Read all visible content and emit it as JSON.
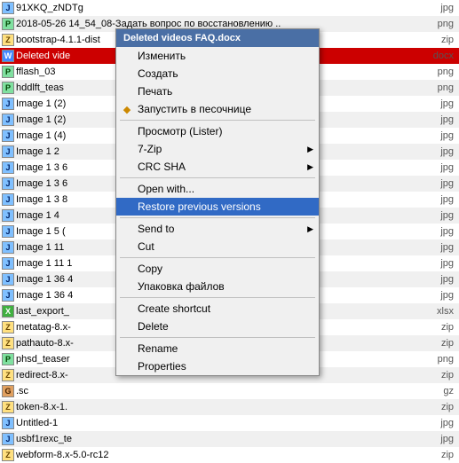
{
  "fileList": {
    "rows": [
      {
        "icon": "jpg",
        "name": "91XKQ_zNDTg",
        "ext": "jpg"
      },
      {
        "icon": "png",
        "name": "2018-05-26 14_54_08-Задать вопрос по восстановлению ..",
        "ext": "png"
      },
      {
        "icon": "zip",
        "name": "bootstrap-4.1.1-dist",
        "ext": "zip"
      },
      {
        "icon": "docx",
        "name": "Deleted vide",
        "ext": "docx",
        "highlighted": true
      },
      {
        "icon": "png",
        "name": "fflash_03",
        "ext": "png"
      },
      {
        "icon": "png",
        "name": "hddlft_teas",
        "ext": "png"
      },
      {
        "icon": "jpg",
        "name": "Image 1 (2)",
        "ext": "jpg"
      },
      {
        "icon": "jpg",
        "name": "Image 1 (2)",
        "ext": "jpg"
      },
      {
        "icon": "jpg",
        "name": "Image 1 (4)",
        "ext": "jpg"
      },
      {
        "icon": "jpg",
        "name": "Image 1 2",
        "ext": "jpg"
      },
      {
        "icon": "jpg",
        "name": "Image 1  3 6",
        "ext": "jpg"
      },
      {
        "icon": "jpg",
        "name": "Image 1  3 6",
        "ext": "jpg"
      },
      {
        "icon": "jpg",
        "name": "Image 1  3 8",
        "ext": "jpg"
      },
      {
        "icon": "jpg",
        "name": "Image 1  4",
        "ext": "jpg"
      },
      {
        "icon": "jpg",
        "name": "Image 1  5 (",
        "ext": "jpg"
      },
      {
        "icon": "jpg",
        "name": "Image 1  11",
        "ext": "jpg"
      },
      {
        "icon": "jpg",
        "name": "Image 1  11 1",
        "ext": "jpg"
      },
      {
        "icon": "jpg",
        "name": "Image 1  36 4",
        "ext": "jpg"
      },
      {
        "icon": "jpg",
        "name": "Image 1  36 4",
        "ext": "jpg"
      },
      {
        "icon": "xlsx",
        "name": "last_export_",
        "ext": "xlsx"
      },
      {
        "icon": "zip",
        "name": "metatag-8.x-",
        "ext": "zip"
      },
      {
        "icon": "zip",
        "name": "pathauto-8.x-",
        "ext": "zip"
      },
      {
        "icon": "png",
        "name": "phsd_teaser",
        "ext": "png"
      },
      {
        "icon": "zip",
        "name": "redirect-8.x-",
        "ext": "zip"
      },
      {
        "icon": "gz",
        "name": ".sc",
        "ext": "gz"
      },
      {
        "icon": "zip",
        "name": "token-8.x-1.",
        "ext": "zip"
      },
      {
        "icon": "jpg",
        "name": "Untitled-1",
        "ext": "jpg"
      },
      {
        "icon": "jpg",
        "name": "usbf1rexc_te",
        "ext": "jpg"
      },
      {
        "icon": "zip",
        "name": "webform-8.x-5.0-rc12",
        "ext": "zip"
      }
    ]
  },
  "contextMenu": {
    "header": "Deleted videos FAQ.docx",
    "items": [
      {
        "label": "Изменить",
        "type": "item"
      },
      {
        "label": "Создать",
        "type": "item"
      },
      {
        "label": "Печать",
        "type": "item"
      },
      {
        "label": "Запустить в песочнице",
        "type": "item",
        "icon": "gem"
      },
      {
        "label": "Просмотр (Lister)",
        "type": "item"
      },
      {
        "label": "7-Zip",
        "type": "item",
        "arrow": true
      },
      {
        "label": "CRC SHA",
        "type": "item",
        "arrow": true
      },
      {
        "label": "Open with...",
        "type": "item"
      },
      {
        "label": "Restore previous versions",
        "type": "item",
        "active": true
      },
      {
        "label": "Send to",
        "type": "item",
        "arrow": true
      },
      {
        "label": "Cut",
        "type": "item"
      },
      {
        "label": "Copy",
        "type": "item"
      },
      {
        "label": "Упаковка файлов",
        "type": "item"
      },
      {
        "label": "Create shortcut",
        "type": "item"
      },
      {
        "label": "Delete",
        "type": "item"
      },
      {
        "label": "Rename",
        "type": "item"
      },
      {
        "label": "Properties",
        "type": "item"
      }
    ]
  }
}
